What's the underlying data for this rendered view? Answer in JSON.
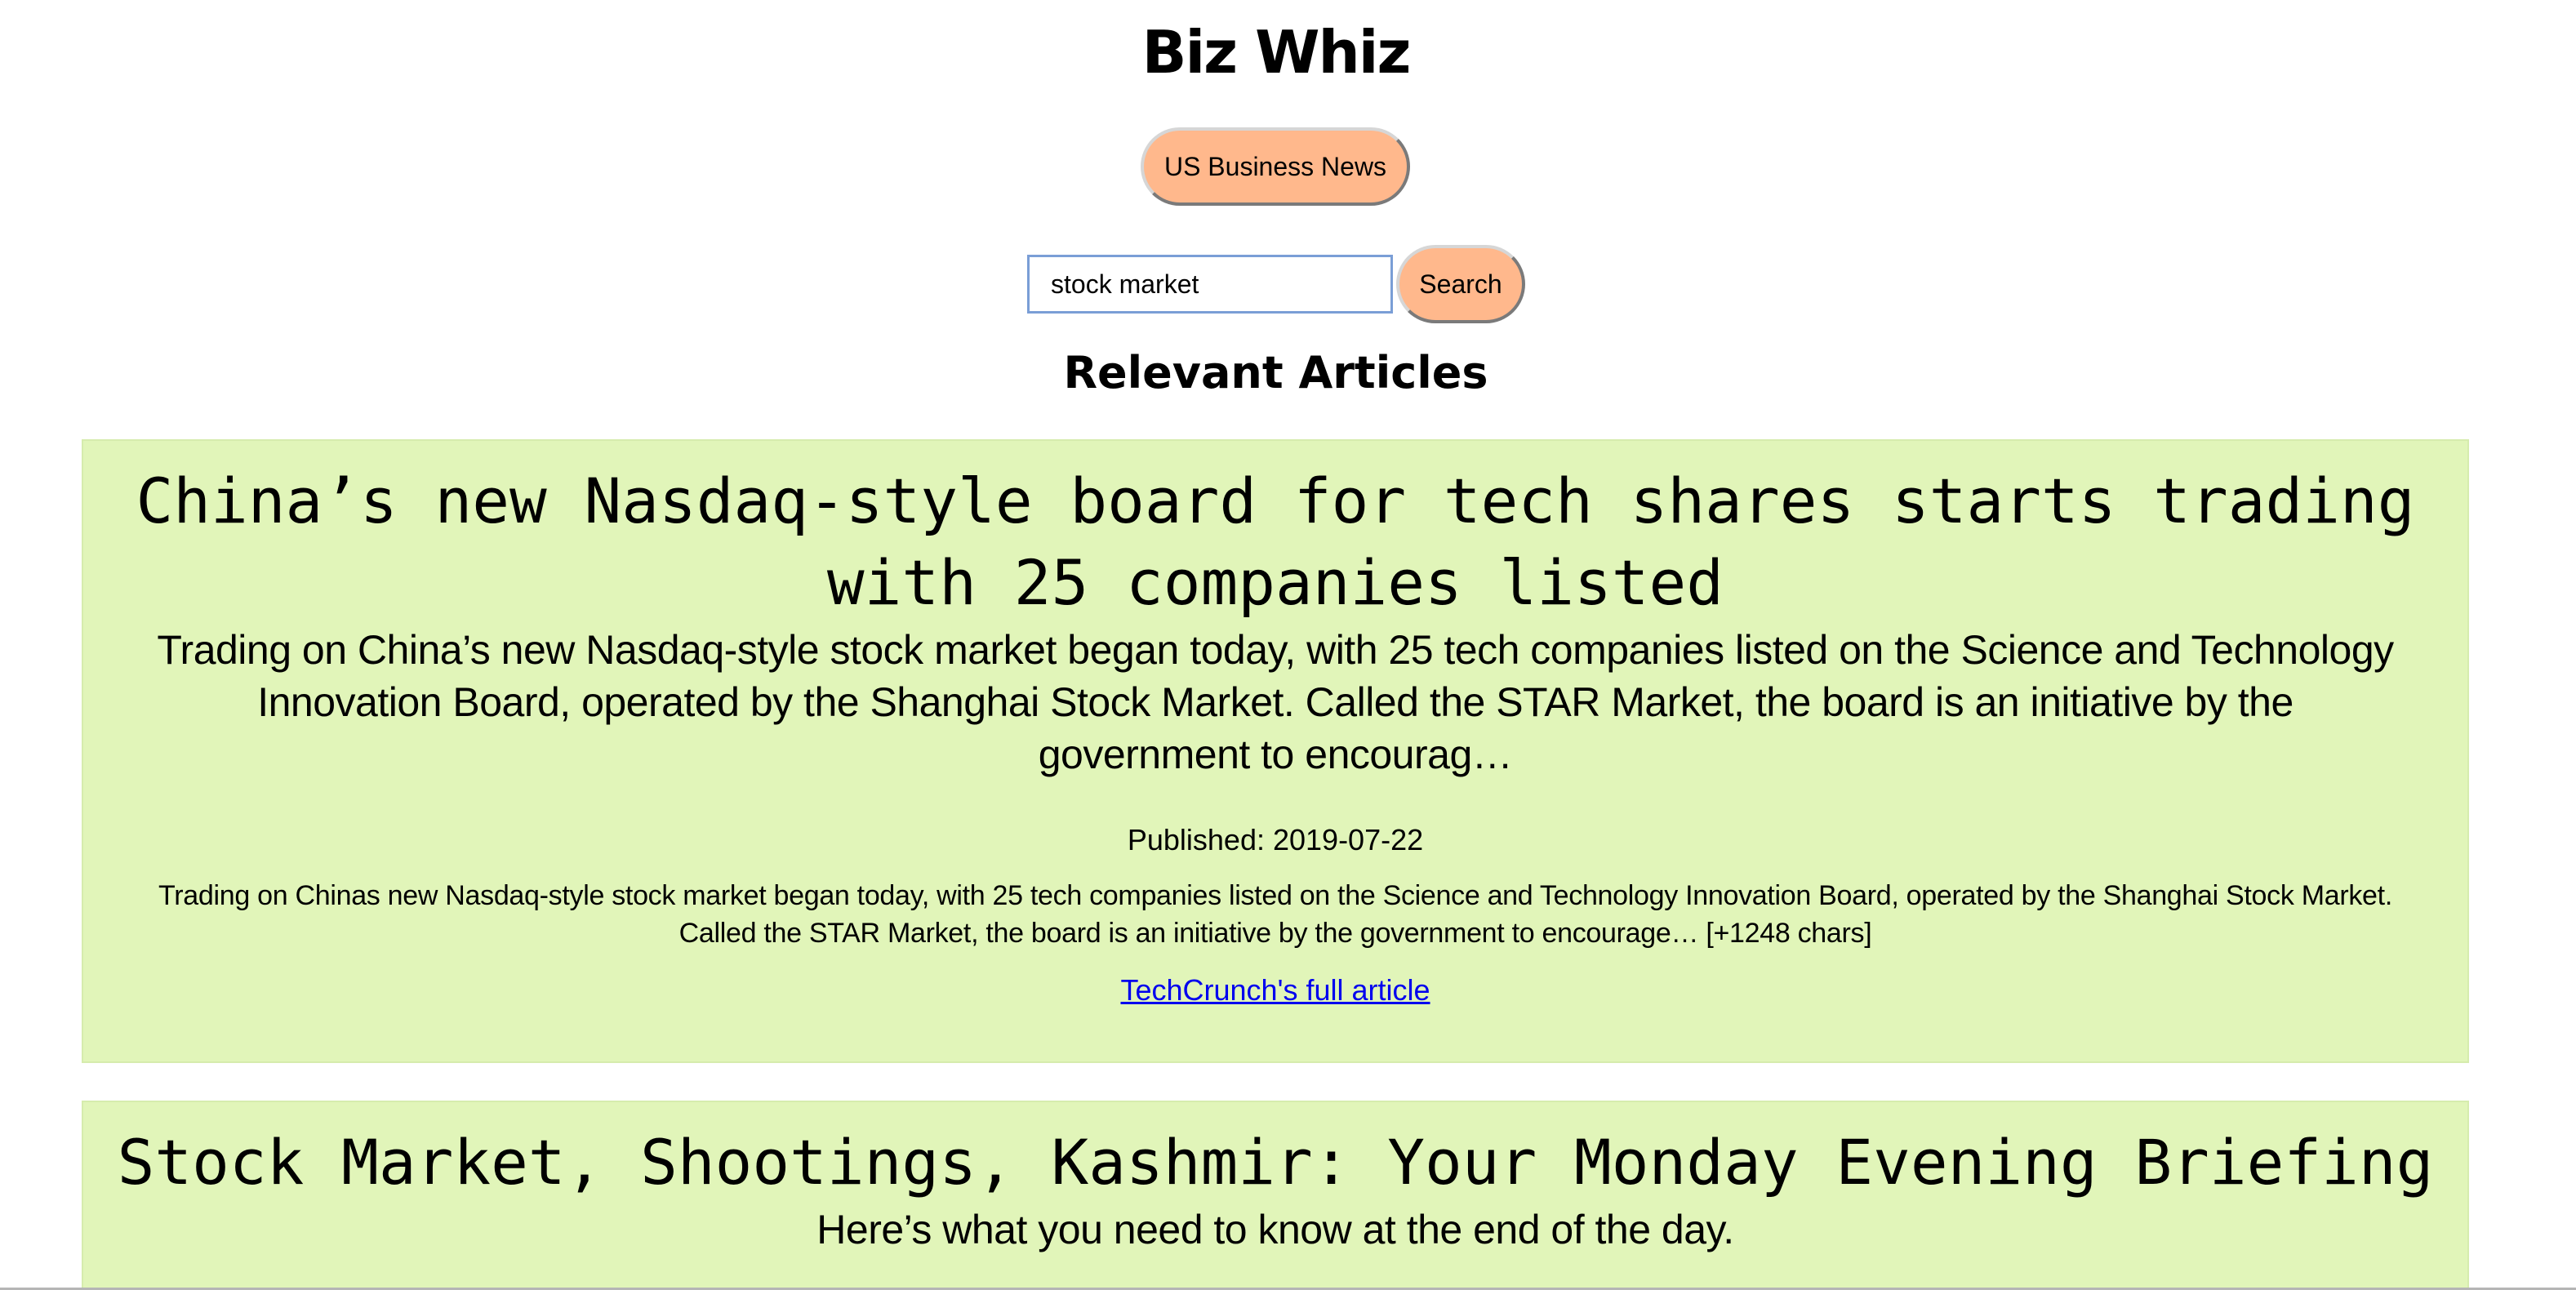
{
  "header": {
    "site_title": "Biz Whiz",
    "nav_button_label": "US Business News"
  },
  "search": {
    "value": "stock market",
    "button_label": "Search"
  },
  "results": {
    "heading": "Relevant Articles",
    "articles": [
      {
        "title": "China’s new Nasdaq-style board for tech shares starts trading with 25 companies listed",
        "description": "Trading on China’s new Nasdaq-style stock market began today, with 25 tech companies listed on the Science and Technology Innovation Board, operated by the Shanghai Stock Market. Called the STAR Market, the board is an initiative by the government to encourag…",
        "published": "Published: 2019-07-22",
        "content": "Trading on Chinas new Nasdaq-style stock market began today, with 25 tech companies listed on the Science and Technology Innovation Board, operated by the Shanghai Stock Market. Called the STAR Market, the board is an initiative by the government to encourage… [+1248 chars]",
        "link_text": "TechCrunch's full article"
      },
      {
        "title": "Stock Market, Shootings, Kashmir: Your Monday Evening Briefing",
        "description": "Here’s what you need to know at the end of the day."
      }
    ]
  },
  "colors": {
    "button_bg": "#ffb88c",
    "card_bg": "#e1f5b9",
    "link": "#0000ee"
  }
}
